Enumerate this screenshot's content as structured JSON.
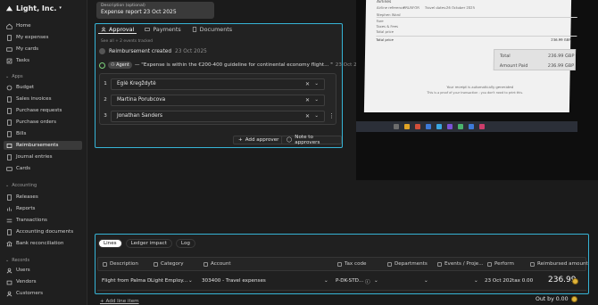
{
  "company": "Light, Inc.",
  "nav": {
    "top": [
      "Home",
      "My expenses",
      "My cards",
      "Tasks"
    ],
    "apps_label": "Apps",
    "apps": [
      "Budget",
      "Sales invoices",
      "Purchase requests",
      "Purchase orders",
      "Bills",
      "Reimbursements",
      "Journal entries",
      "Cards"
    ],
    "accounting_label": "Accounting",
    "accounting": [
      "Releases",
      "Reports",
      "Transactions",
      "Accounting documents",
      "Bank reconciliation"
    ],
    "records_label": "Records",
    "records": [
      "Users",
      "Vendors",
      "Customers"
    ]
  },
  "description": {
    "label": "Description (optional)",
    "value": "Expense report 23 Oct 2025"
  },
  "approval": {
    "tabs": [
      "Approval",
      "Payments",
      "Documents"
    ],
    "events_link": "See all + 2 events tracked",
    "created_text": "Reimbursement created",
    "created_date": "23 Oct 2025",
    "agent_label": "Agent",
    "agent_message": "— \"Expense is within the €200-400 guideline for continental economy flight... \"",
    "agent_date": "23 Oct 2025",
    "approvers": [
      {
        "num": "1",
        "name": "Eglė Kregždytė"
      },
      {
        "num": "2",
        "name": "Martina Porubcova"
      },
      {
        "num": "3",
        "name": "Jonathan Sanders"
      }
    ],
    "add_approver": "Add approver",
    "note_to_approvers": "Note to approvers"
  },
  "receipt": {
    "airline_label": "Airlines",
    "airline_ref_label": "Airline reference:",
    "airline_ref": "PRU5FOR",
    "travel_dates_label": "Travel dates:",
    "travel_dates": "26 October 2025",
    "passenger": "Stephen Ward",
    "rows": [
      "Fare",
      "Taxes & Fees",
      "Total price"
    ],
    "total_price_label": "Total price",
    "total_price": "236.99 GBP",
    "total_label": "Total",
    "total_value": "236.99 GBP",
    "amount_paid_label": "Amount Paid",
    "amount_paid_value": "236.99 GBP",
    "footer_title": "Your receipt is automatically generated",
    "footer_note": "This is a proof of your transaction - you don't need to print this."
  },
  "lines": {
    "segments": [
      "Lines",
      "Ledger impact",
      "Log"
    ],
    "headers": [
      "Description",
      "Category",
      "Account",
      "Tax code",
      "Departments",
      "Events / Proje...",
      "Perform",
      "Reimbursed amount"
    ],
    "row": {
      "description": "Flight from Palma D",
      "category": "Light Employ...",
      "account": "303400 - Travel expenses",
      "tax_code": "P-DK-STD...",
      "date": "23 Oct 202",
      "tax": "tax 0.00",
      "amount": "236.99"
    },
    "add_line": "+ Add line item",
    "out_by": "Out by 0.00"
  }
}
